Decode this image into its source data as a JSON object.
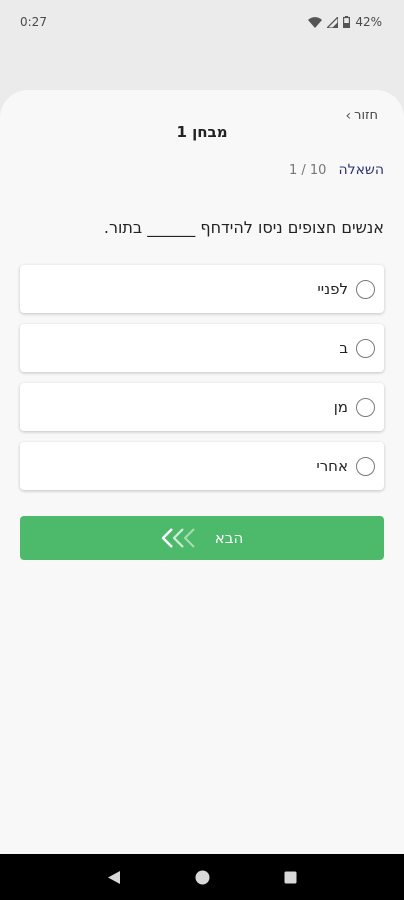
{
  "status_bar": {
    "time": "0:27",
    "battery": "42%"
  },
  "header": {
    "back_label": "חזור",
    "title": "מבחן 1"
  },
  "question": {
    "label": "השאלה",
    "counter": "1 / 10",
    "text": "אנשים חצופים ניסו להידחף ______ בתור."
  },
  "options": [
    {
      "label": "לפניי"
    },
    {
      "label": "ב"
    },
    {
      "label": "מן"
    },
    {
      "label": "אחרי"
    }
  ],
  "next_button": {
    "label": "הבא"
  },
  "colors": {
    "accent": "#4cba6a",
    "question_label": "#2e3270"
  }
}
